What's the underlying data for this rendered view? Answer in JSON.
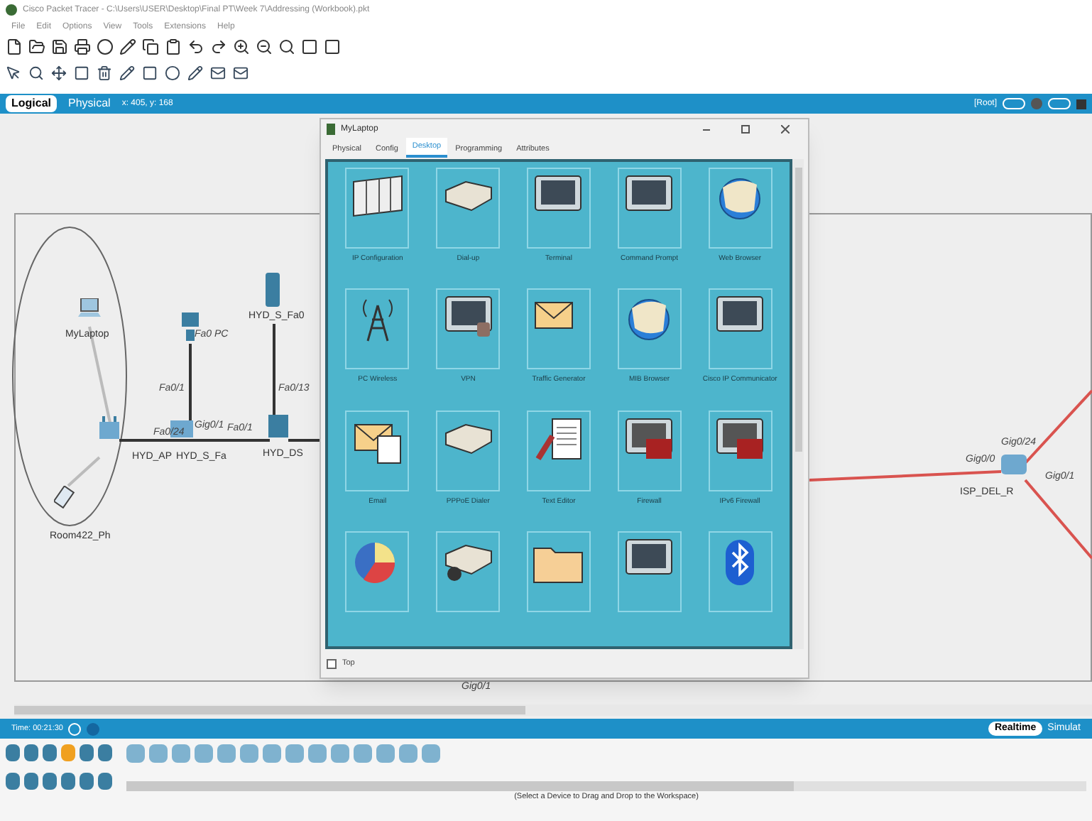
{
  "window": {
    "title": "Cisco Packet Tracer - C:\\Users\\USER\\Desktop\\Final PT\\Week 7\\Addressing (Workbook).pkt"
  },
  "menu": [
    "File",
    "Edit",
    "Options",
    "View",
    "Tools",
    "Extensions",
    "Help"
  ],
  "view_tabs": [
    {
      "label": "Logical",
      "selected": true
    },
    {
      "label": "Physical",
      "selected": false
    }
  ],
  "coordinates": "x: 405, y: 168",
  "right_bar": {
    "label": "[Root]"
  },
  "canvas_labels": [
    {
      "text": "MyLaptop",
      "kind": "device"
    },
    {
      "text": "Fa0 PC",
      "kind": "port"
    },
    {
      "text": "HYD_S_Fa0",
      "kind": "device"
    },
    {
      "text": "Fa0/1",
      "kind": "port"
    },
    {
      "text": "Fa0/13",
      "kind": "port"
    },
    {
      "text": "Gig0/1",
      "kind": "port"
    },
    {
      "text": "Fa0/1",
      "kind": "port"
    },
    {
      "text": "Fa0/24",
      "kind": "port"
    },
    {
      "text": "HYD_AP",
      "kind": "device"
    },
    {
      "text": "HYD_S_Fa",
      "kind": "device"
    },
    {
      "text": "HYD_DS",
      "kind": "device"
    },
    {
      "text": "Room422_Ph",
      "kind": "device"
    },
    {
      "text": "Gig0/24",
      "kind": "port"
    },
    {
      "text": "Gig0/0",
      "kind": "port"
    },
    {
      "text": "Gig0/1",
      "kind": "port"
    },
    {
      "text": "ISP_DEL_R",
      "kind": "device"
    },
    {
      "text": "Gig0/1",
      "kind": "port"
    }
  ],
  "dialog": {
    "title": "MyLaptop",
    "tabs": [
      {
        "label": "Physical",
        "selected": false
      },
      {
        "label": "Config",
        "selected": false
      },
      {
        "label": "Desktop",
        "selected": true
      },
      {
        "label": "Programming",
        "selected": false
      },
      {
        "label": "Attributes",
        "selected": false
      }
    ],
    "apps": [
      {
        "kind": "labeled",
        "label": "IP Configuration"
      },
      {
        "kind": "labeled",
        "label": "Dial-up"
      },
      {
        "kind": "labeled",
        "label": "Terminal"
      },
      {
        "kind": "labeled",
        "label": "Command Prompt"
      },
      {
        "kind": "labeled",
        "label": "Web Browser"
      },
      {
        "kind": "labeled",
        "label": "PC Wireless"
      },
      {
        "kind": "labeled",
        "label": "VPN"
      },
      {
        "kind": "labeled",
        "label": "Traffic Generator"
      },
      {
        "kind": "labeled",
        "label": "MIB Browser"
      },
      {
        "kind": "labeled",
        "label": "Cisco IP Communicator"
      },
      {
        "kind": "labeled",
        "label": "Email"
      },
      {
        "kind": "labeled",
        "label": "PPPoE Dialer"
      },
      {
        "kind": "labeled",
        "label": "Text Editor"
      },
      {
        "kind": "labeled",
        "label": "Firewall"
      },
      {
        "kind": "labeled",
        "label": "IPv6 Firewall"
      },
      {
        "kind": "cut"
      },
      {
        "kind": "cut"
      },
      {
        "kind": "cut"
      },
      {
        "kind": "cut"
      },
      {
        "kind": "cut"
      }
    ],
    "top": {
      "label": "Top",
      "checked": false
    }
  },
  "bottom_bar": {
    "time": "Time: 00:21:30",
    "realtime": "Realtime",
    "simulation": "Simulat"
  },
  "status_text": "(Select a Device to Drag and Drop to the Workspace)"
}
